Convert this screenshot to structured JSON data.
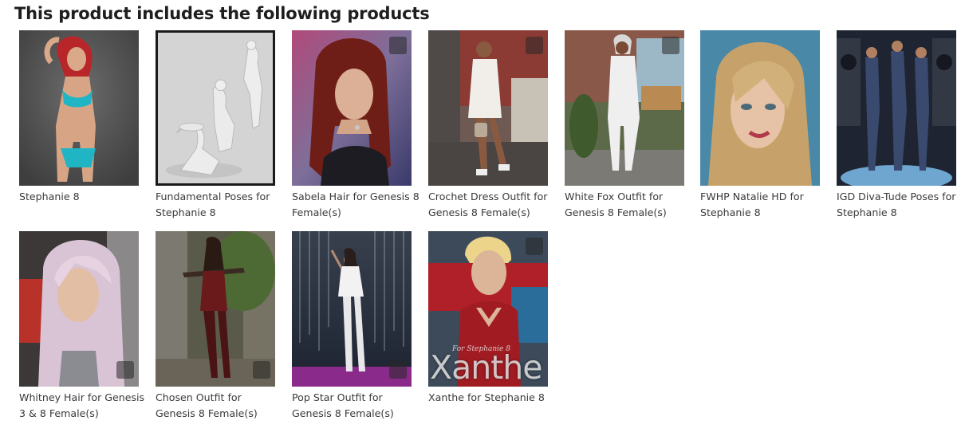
{
  "section": {
    "heading": "This product includes the following products"
  },
  "products": [
    {
      "title": "Stephanie 8",
      "image_icon": "stephanie-8-thumbnail"
    },
    {
      "title": "Fundamental Poses for Stephanie 8",
      "image_icon": "fundamental-poses-thumbnail"
    },
    {
      "title": "Sabela Hair for Genesis 8 Female(s)",
      "image_icon": "sabela-hair-thumbnail"
    },
    {
      "title": "Crochet Dress Outfit for Genesis 8 Female(s)",
      "image_icon": "crochet-dress-thumbnail"
    },
    {
      "title": "White Fox Outfit for Genesis 8 Female(s)",
      "image_icon": "white-fox-outfit-thumbnail"
    },
    {
      "title": "FWHP Natalie HD for Stephanie 8",
      "image_icon": "natalie-hd-thumbnail"
    },
    {
      "title": "IGD Diva-Tude Poses for Stephanie 8",
      "image_icon": "diva-tude-poses-thumbnail"
    },
    {
      "title": "Whitney Hair for Genesis 3 & 8 Female(s)",
      "image_icon": "whitney-hair-thumbnail"
    },
    {
      "title": "Chosen Outfit for Genesis 8 Female(s)",
      "image_icon": "chosen-outfit-thumbnail"
    },
    {
      "title": "Pop Star Outfit for Genesis 8 Female(s)",
      "image_icon": "pop-star-outfit-thumbnail"
    },
    {
      "title": "Xanthe for Stephanie 8",
      "image_icon": "xanthe-thumbnail",
      "image_text": "Xanthe",
      "image_subtext": "For Stephanie 8"
    }
  ]
}
